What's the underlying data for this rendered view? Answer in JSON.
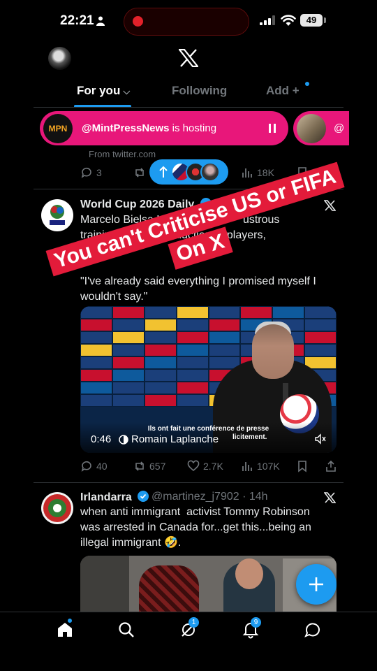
{
  "status_bar": {
    "time": "22:21",
    "battery": "49"
  },
  "tabs": [
    {
      "label": "For you",
      "suffix": "⌵"
    },
    {
      "label": "Following"
    },
    {
      "label": "Add",
      "suffix": "+"
    }
  ],
  "spaces": {
    "logo_text": "MPN",
    "host": "@MintPressNews",
    "hosting_text": " is hosting",
    "second_prefix": "@"
  },
  "prev_tweet": {
    "source": "From twitter.com",
    "replies": "3",
    "views": "18K"
  },
  "tweet1": {
    "name": "World Cup 2026 Daily",
    "handle": "@T",
    "text": "Marcelo Bielsa Uru          ...         ustrous\ntraining pit            oduction ... players,\nof                                 as.\"\n\n\"I've already said everything I promised myself I\nwouldn't say.\"",
    "video": {
      "time": "0:46",
      "author": "Romain Laplanche",
      "subtitle_line1": "Ils ont fait une conférence de presse",
      "subtitle_line2": "licitement."
    },
    "replies": "40",
    "reposts": "657",
    "likes": "2.7K",
    "views": "107K"
  },
  "overlay": {
    "line1": "You can't Criticise US or FIFA",
    "line2": "On X",
    "color": "#e31b3a"
  },
  "tweet2": {
    "name": "Irlandarra",
    "handle": "@martinez_j7902 · 14h",
    "text": "when anti immigrant  activist Tommy Robinson\nwas arrested in Canada for...get this...being an\nillegal immigrant 🤣."
  },
  "nav": {
    "communities_badge": "1",
    "notifications_badge": "9"
  },
  "colors": {
    "accent": "#1d9bf0",
    "spaces": "#e8177a"
  }
}
